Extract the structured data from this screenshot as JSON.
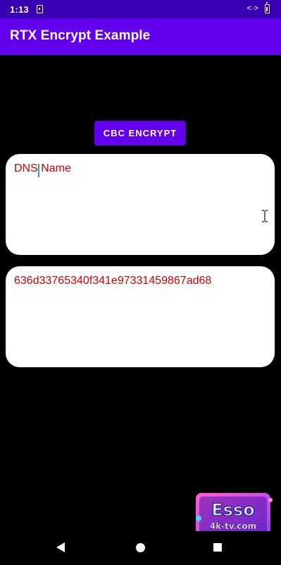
{
  "status_bar": {
    "time": "1:13",
    "data_icon_glyph": "<·>"
  },
  "app_bar": {
    "title": "RTX Encrypt Example"
  },
  "encrypt_button": {
    "label": "CBC ENCRYPT"
  },
  "input_field": {
    "value": "DNS Name"
  },
  "output_field": {
    "value": "636d33765340f341e97331459867ad68"
  },
  "watermark": {
    "brand": "Esso",
    "domain": "4k-tv.com"
  },
  "colors": {
    "status_bar": "#3700b3",
    "app_bar": "#6200ee",
    "button": "#6200ee",
    "field_text": "#cc0000",
    "cursor": "#26a69a"
  }
}
